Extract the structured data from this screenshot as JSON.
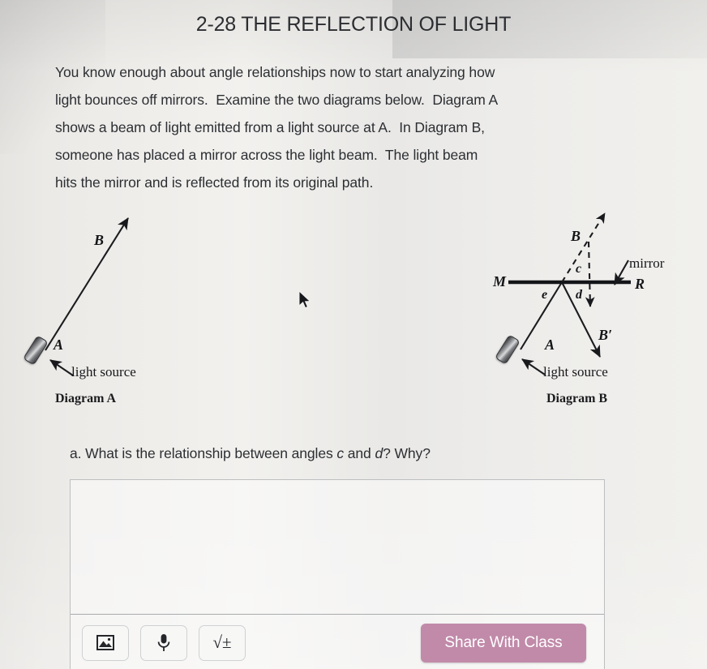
{
  "page": {
    "title": "2-28 THE REFLECTION OF LIGHT",
    "background_color": "#efeeeb"
  },
  "intro": {
    "line1": "You know enough about angle relationships now to start analyzing how",
    "line2": "light bounces off mirrors.  Examine the two diagrams below.  Diagram A",
    "line3": "shows a beam of light emitted from a light source at A.  In Diagram B,",
    "line4": "someone has placed a mirror across the light beam.  The light beam",
    "line5": "hits the mirror and is reflected from its original path."
  },
  "diagram_a": {
    "caption": "Diagram A",
    "label_a": "A",
    "label_b": "B",
    "light_source_label": "light source"
  },
  "diagram_b": {
    "caption": "Diagram B",
    "label_a": "A",
    "label_b": "B",
    "label_b_prime": "B′",
    "label_c": "c",
    "label_d": "d",
    "label_e": "e",
    "label_m": "M",
    "label_r": "R",
    "mirror_label": "mirror",
    "light_source_label": "light source"
  },
  "question": {
    "prefix": "a. What is the relationship between angles ",
    "angle1": "c",
    "middle": " and ",
    "angle2": "d",
    "suffix": "?  Why?"
  },
  "answer": {
    "value": "",
    "placeholder": ""
  },
  "toolbar": {
    "image_button_icon": "image-icon",
    "mic_button_icon": "microphone-icon",
    "math_button_label": "√±",
    "share_label": "Share With Class",
    "share_color": "#c18aa9"
  }
}
